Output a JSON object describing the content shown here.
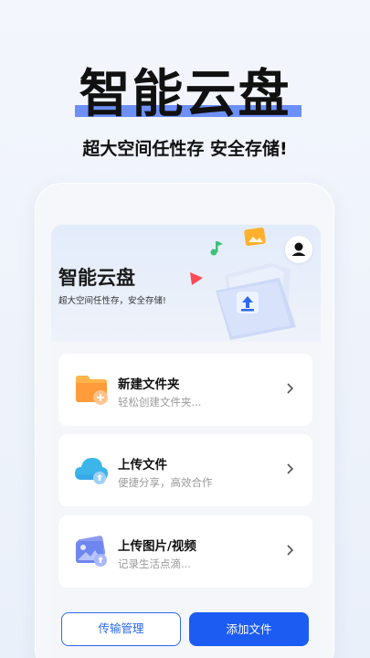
{
  "hero": {
    "title": "智能云盘",
    "subtitle": "超大空间任性存 安全存储!"
  },
  "app": {
    "title": "智能云盘",
    "subtitle": "超大空间任性存，安全存储!"
  },
  "cards": [
    {
      "title": "新建文件夹",
      "desc": "轻松创建文件夹...",
      "icon": "folder-icon"
    },
    {
      "title": "上传文件",
      "desc": "便捷分享，高效合作",
      "icon": "cloud-upload-icon"
    },
    {
      "title": "上传图片/视频",
      "desc": "记录生活点滴...",
      "icon": "image-upload-icon"
    }
  ],
  "buttons": {
    "transfer": "传输管理",
    "add_file": "添加文件"
  },
  "colors": {
    "accent": "#1c5cf2",
    "underline": "#3f6df5"
  }
}
